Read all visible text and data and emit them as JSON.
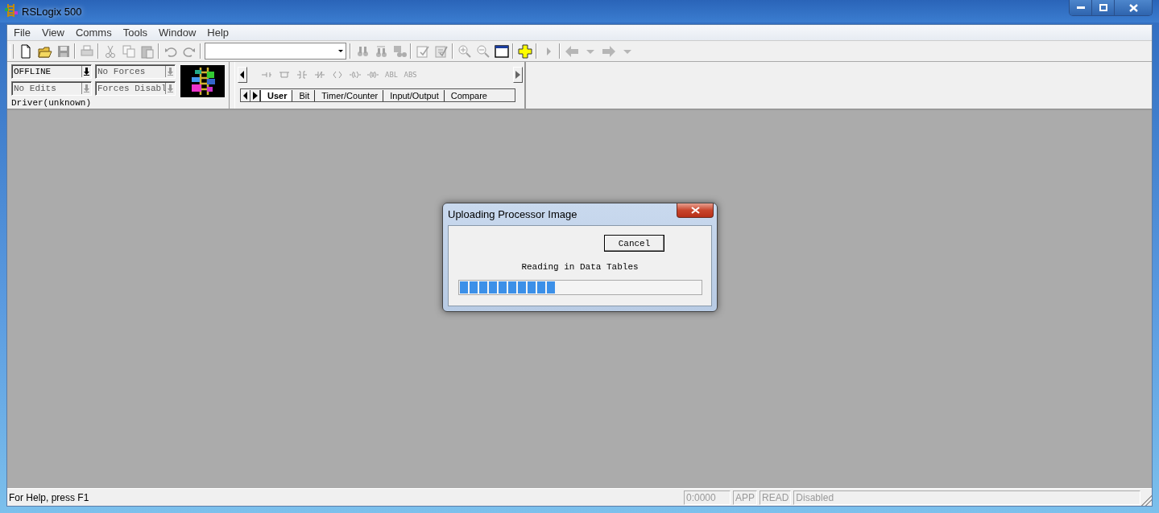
{
  "window": {
    "title": "RSLogix 500"
  },
  "menu": [
    "File",
    "View",
    "Comms",
    "Tools",
    "Window",
    "Help"
  ],
  "toolbar": [
    {
      "kind": "new",
      "disabled": false
    },
    {
      "kind": "open",
      "disabled": false
    },
    {
      "kind": "save",
      "disabled": true
    },
    {
      "kind": "separator"
    },
    {
      "kind": "print",
      "disabled": true
    },
    {
      "kind": "separator"
    },
    {
      "kind": "cut",
      "disabled": true
    },
    {
      "kind": "copy",
      "disabled": true
    },
    {
      "kind": "paste",
      "disabled": true
    },
    {
      "kind": "separator"
    },
    {
      "kind": "undo",
      "disabled": true
    },
    {
      "kind": "redo",
      "disabled": true
    },
    {
      "kind": "separator"
    },
    {
      "kind": "combo"
    },
    {
      "kind": "separator"
    },
    {
      "kind": "find",
      "disabled": true
    },
    {
      "kind": "replace",
      "disabled": true
    },
    {
      "kind": "find-all",
      "disabled": true
    },
    {
      "kind": "separator"
    },
    {
      "kind": "verify-file",
      "disabled": true
    },
    {
      "kind": "verify-project",
      "disabled": true
    },
    {
      "kind": "separator"
    },
    {
      "kind": "zoom-in",
      "disabled": true
    },
    {
      "kind": "zoom-out",
      "disabled": true
    },
    {
      "kind": "window",
      "disabled": false
    },
    {
      "kind": "separator"
    },
    {
      "kind": "add",
      "disabled": false
    },
    {
      "kind": "separator"
    },
    {
      "kind": "play",
      "disabled": true
    },
    {
      "kind": "separator"
    },
    {
      "kind": "back",
      "disabled": true
    },
    {
      "kind": "dropdown",
      "disabled": true
    },
    {
      "kind": "forward",
      "disabled": true
    },
    {
      "kind": "dropdown",
      "disabled": true
    }
  ],
  "status_panel": {
    "fields": [
      {
        "value": "OFFLINE",
        "disabled": false
      },
      {
        "value": "No Forces",
        "disabled": true
      },
      {
        "value": "No Edits",
        "disabled": true
      },
      {
        "value": "Forces Disabl",
        "disabled": true
      }
    ],
    "driver": "Driver(unknown)"
  },
  "instruction_palette": {
    "instructions": [
      {
        "kind": "rung"
      },
      {
        "kind": "branch"
      },
      {
        "kind": "xic"
      },
      {
        "kind": "xio"
      },
      {
        "kind": "ote"
      },
      {
        "kind": "otl"
      },
      {
        "kind": "otu"
      },
      {
        "kind": "mnemonic",
        "label": "ABL"
      },
      {
        "kind": "mnemonic",
        "label": "ABS"
      }
    ],
    "tabs": [
      {
        "label": "User",
        "selected": true
      },
      {
        "label": "Bit",
        "selected": false
      },
      {
        "label": "Timer/Counter",
        "selected": false
      },
      {
        "label": "Input/Output",
        "selected": false
      },
      {
        "label": "Compare",
        "selected": false
      }
    ]
  },
  "dialog": {
    "title": "Uploading Processor Image",
    "button": "Cancel",
    "message": "Reading in Data Tables",
    "progress": {
      "level": 0.4
    }
  },
  "status_bar": {
    "help": "For Help, press F1",
    "panes": [
      {
        "text": "0:0000"
      },
      {
        "text": "APP"
      },
      {
        "text": "READ"
      },
      {
        "text": "Disabled"
      }
    ]
  }
}
